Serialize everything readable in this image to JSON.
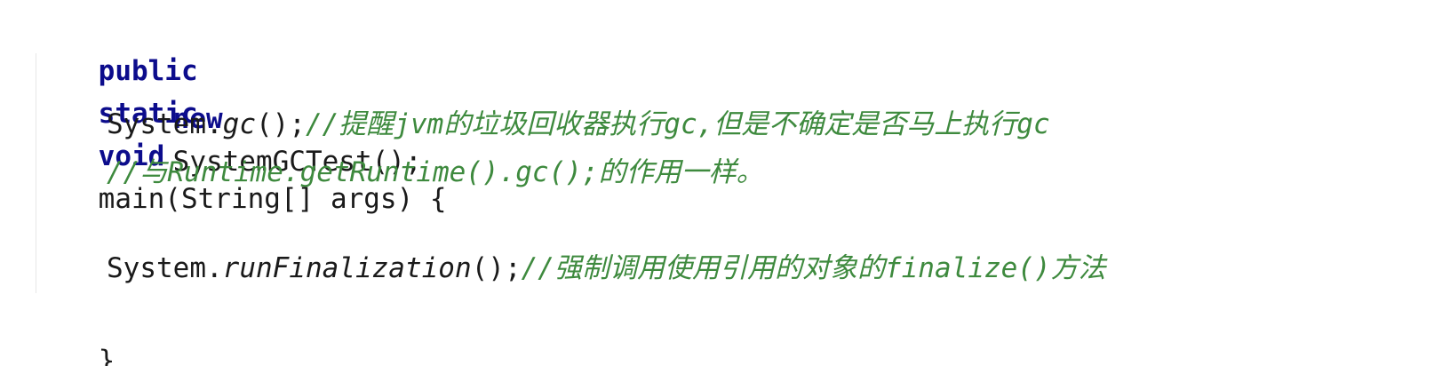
{
  "code": {
    "line1": {
      "kw_public": "public",
      "kw_static": "static",
      "kw_void": "void",
      "signature": "main(String[] args) {"
    },
    "line2": {
      "kw_new": "new",
      "text": "SystemGCTest();"
    },
    "line3": {
      "receiver": "System.",
      "method": "gc",
      "call": "();",
      "comment": "//提醒jvm的垃圾回收器执行gc,但是不确定是否马上执行gc"
    },
    "line4": {
      "comment": "//与Runtime.getRuntime().gc();的作用一样。"
    },
    "line6": {
      "receiver": "System.",
      "method": "runFinalization",
      "call": "();",
      "comment": "//强制调用使用引用的对象的finalize()方法"
    },
    "line7": {
      "brace": "}"
    }
  },
  "colors": {
    "keyword": "#0c0c8c",
    "comment": "#3e8a3e",
    "text": "#1a1a1a"
  }
}
